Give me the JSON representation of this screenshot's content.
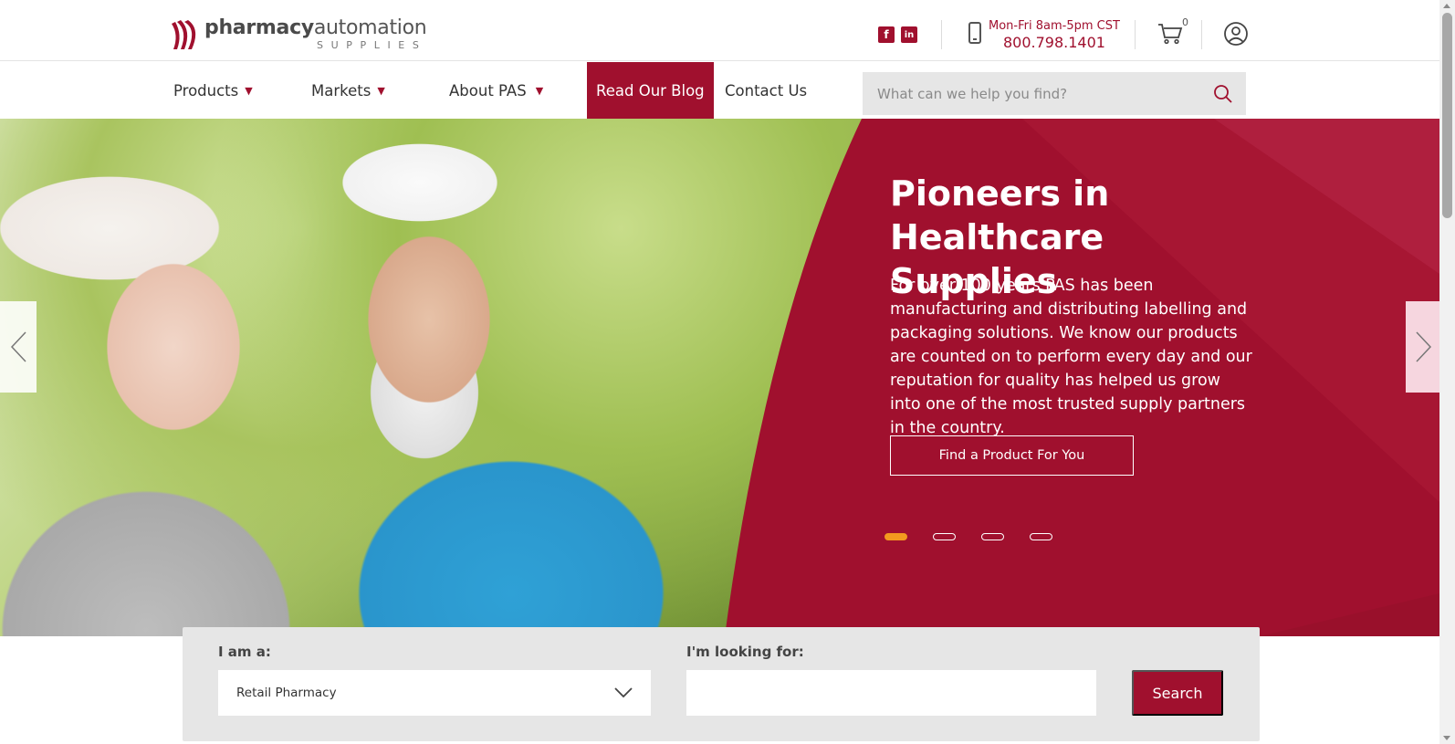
{
  "header": {
    "logo": {
      "name_bold": "pharmacy",
      "name_rest": "automation",
      "sub": "SUPPLIES"
    },
    "social": {
      "facebook_glyph": "f",
      "linkedin_glyph": "in"
    },
    "contact": {
      "hours": "Mon-Fri 8am-5pm CST",
      "phone": "800.798.1401"
    },
    "cart": {
      "count": "0"
    },
    "icons": [
      "phone-icon",
      "cart-icon",
      "account-icon",
      "facebook-icon",
      "linkedin-icon"
    ]
  },
  "nav": {
    "items": [
      {
        "label": "Products",
        "dropdown": true
      },
      {
        "label": "Markets",
        "dropdown": true
      },
      {
        "label": "About PAS",
        "dropdown": true
      },
      {
        "label": "Read Our Blog",
        "dropdown": false
      },
      {
        "label": "Contact Us",
        "dropdown": false
      }
    ],
    "caret": "▼",
    "search": {
      "placeholder": "What can we help you find?",
      "value": ""
    }
  },
  "hero": {
    "title": "Pioneers in Healthcare Supplies",
    "text": "For over 100 years PAS has been manufacturing and distributing labelling and packaging solutions. We know our products are counted on to perform every day and our reputation for quality has helped us grow into one of the most trusted supply partners in the country.",
    "cta": "Find a Product For You",
    "slides_total": 4,
    "active_slide": 1
  },
  "finder": {
    "role_label": "I am a:",
    "role_value": "Retail Pharmacy",
    "looking_label": "I'm looking for:",
    "looking_value": "",
    "search_label": "Search"
  },
  "colors": {
    "brand": "#a0102e",
    "accent": "#f39a1f",
    "panel_bg": "#e6e6e6"
  }
}
